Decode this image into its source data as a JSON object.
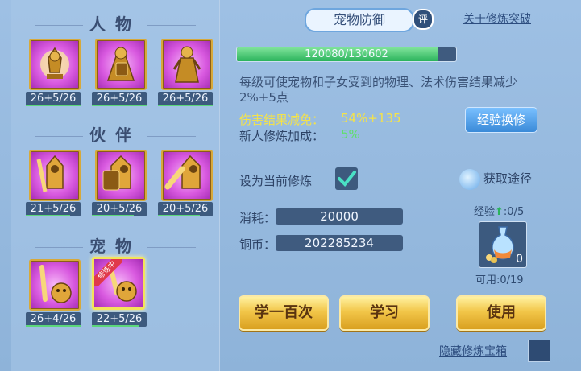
{
  "categories": [
    {
      "title": "人物",
      "skills": [
        {
          "icon": "character-skill-1-icon",
          "level": "26+5/26"
        },
        {
          "icon": "character-skill-2-icon",
          "level": "26+5/26"
        },
        {
          "icon": "character-skill-3-icon",
          "level": "26+5/26"
        }
      ]
    },
    {
      "title": "伙伴",
      "skills": [
        {
          "icon": "partner-skill-1-icon",
          "level": "21+5/26"
        },
        {
          "icon": "partner-skill-2-icon",
          "level": "20+5/26"
        },
        {
          "icon": "partner-skill-3-icon",
          "level": "20+5/26"
        }
      ]
    },
    {
      "title": "宠物",
      "skills": [
        {
          "icon": "pet-attack-icon",
          "level": "26+4/26"
        },
        {
          "icon": "pet-defense-icon",
          "level": "22+5/26",
          "training_tag": "修炼中"
        }
      ]
    }
  ],
  "detail": {
    "title": "宠物防御",
    "eval_badge": "评",
    "breakthrough_link": "关于修炼突破",
    "exp_text": "120080/130602",
    "exp_progress": 0.919,
    "description": "每级可使宠物和子女受到的物理、法术伤害结果减少2%+5点",
    "damage_reduction_label": "伤害结果减免：",
    "damage_reduction_value": "54%+135",
    "newbie_bonus_label": "新人修炼加成：",
    "newbie_bonus_value": "5%",
    "exp_exchange_button": "经验换修",
    "set_current_label": "设为当前修炼",
    "obtain_label": "获取途径",
    "cost_label": "消耗：",
    "cost_value": "20000",
    "coins_label": "铜币：",
    "coins_value": "202285234",
    "exp_item_label": "经验",
    "exp_item_count": ":0/5",
    "item_quantity": "0",
    "usable_label": "可用:0/19",
    "learn_hundred_button": "学一百次",
    "learn_button": "学习",
    "use_button": "使用",
    "hide_chest_label": "隐藏修炼宝箱"
  },
  "colors": {
    "accent_yellow": "#f3e24b",
    "accent_green": "#5fe06a",
    "text_blue": "#3a5276"
  }
}
